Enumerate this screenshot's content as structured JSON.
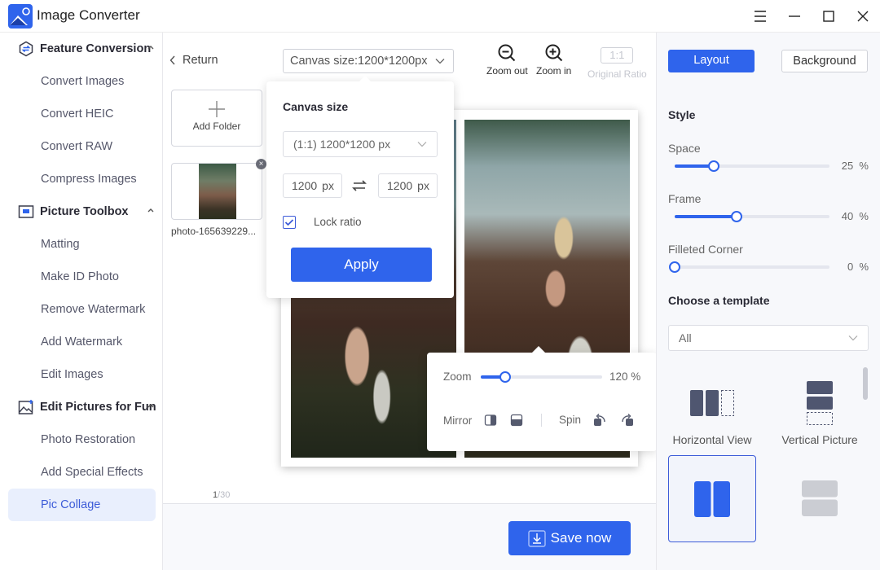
{
  "app": {
    "title": "Image Converter",
    "window_controls": [
      "menu-icon",
      "minimize-icon",
      "maximize-icon",
      "close-icon"
    ]
  },
  "sidebar": {
    "groups": [
      {
        "label": "Feature Conversion",
        "icon": "convert-icon",
        "expanded": true,
        "items": [
          "Convert Images",
          "Convert HEIC",
          "Convert RAW",
          "Compress Images"
        ]
      },
      {
        "label": "Picture Toolbox",
        "icon": "toolbox-icon",
        "expanded": true,
        "items": [
          "Matting",
          "Make ID Photo",
          "Remove Watermark",
          "Add Watermark",
          "Edit Images"
        ]
      },
      {
        "label": "Edit Pictures for Fun",
        "icon": "image-sparkle-icon",
        "expanded": true,
        "items": [
          "Photo Restoration",
          "Add Special Effects",
          "Pic Collage"
        ]
      }
    ],
    "active_item": "Pic Collage"
  },
  "toolbar": {
    "return_label": "Return",
    "canvas_size_label": "Canvas size:1200*1200px",
    "zoom_out_label": "Zoom out",
    "zoom_in_label": "Zoom in",
    "original_ratio_box": "1:1",
    "original_ratio_label": "Original Ratio"
  },
  "files": {
    "add_folder_label": "Add Folder",
    "items": [
      {
        "name": "photo-165639229..."
      }
    ],
    "page_current": "1",
    "page_total": "/30"
  },
  "canvas_popover": {
    "title": "Canvas size",
    "preset_value": "(1:1) 1200*1200 px",
    "width_value": "1200",
    "height_value": "1200",
    "unit": "px",
    "lock_ratio_label": "Lock ratio",
    "lock_ratio_checked": true,
    "apply_label": "Apply"
  },
  "photo_popover": {
    "zoom_label": "Zoom",
    "zoom_value_percent": 120,
    "zoom_fraction": 0.2,
    "zoom_display": "120 %",
    "mirror_label": "Mirror",
    "spin_label": "Spin"
  },
  "right_panel": {
    "tabs": [
      "Layout",
      "Background"
    ],
    "active_tab": "Layout",
    "style_title": "Style",
    "sliders": [
      {
        "label": "Space",
        "value": 25,
        "display": "25  %"
      },
      {
        "label": "Frame",
        "value": 40,
        "display": "40  %"
      },
      {
        "label": "Filleted Corner",
        "value": 0,
        "display": "0  %"
      }
    ],
    "template_title": "Choose a template",
    "template_filter": "All",
    "templates": [
      {
        "label": "Horizontal View"
      },
      {
        "label": "Vertical Picture"
      }
    ],
    "accent_color": "#2f64ec"
  },
  "footer": {
    "save_label": "Save now"
  }
}
